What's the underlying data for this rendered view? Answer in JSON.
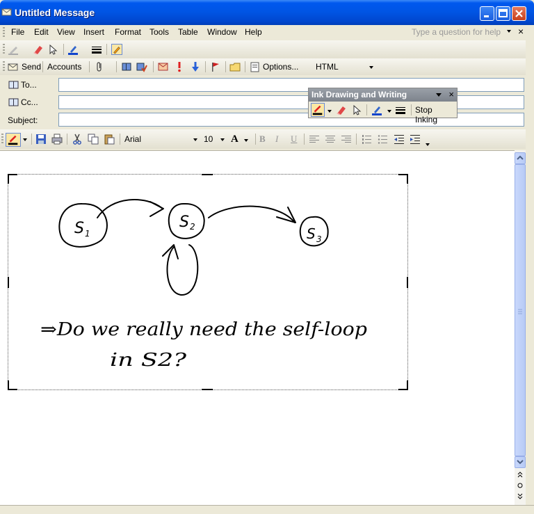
{
  "window": {
    "title": "Untitled Message"
  },
  "menu": {
    "items": [
      "File",
      "Edit",
      "View",
      "Insert",
      "Format",
      "Tools",
      "Table",
      "Window",
      "Help"
    ],
    "help_placeholder": "Type a question for help",
    "close_glyph": "×"
  },
  "toolbar2": {
    "send_label": "Send",
    "accounts_label": "Accounts",
    "options_label": "Options...",
    "format_value": "HTML"
  },
  "header": {
    "to_label": "To...",
    "cc_label": "Cc...",
    "subject_label": "Subject:",
    "to_value": "",
    "cc_value": "",
    "subject_value": ""
  },
  "format_toolbar": {
    "font": "Arial",
    "size": "10",
    "bold_glyph": "B",
    "italic_glyph": "I",
    "underline_glyph": "U",
    "font_color_glyph": "A"
  },
  "ink_panel": {
    "title": "Ink Drawing and Writing",
    "stop_label": "Stop Inking",
    "close_glyph": "×"
  },
  "ink_content": {
    "states": [
      "S1",
      "S2",
      "S3"
    ],
    "note_line1": "⇒Do we really need the self-loop",
    "note_line2": "in S2?"
  },
  "colors": {
    "titlebar": "#0055e5",
    "chrome": "#ece9d8"
  }
}
